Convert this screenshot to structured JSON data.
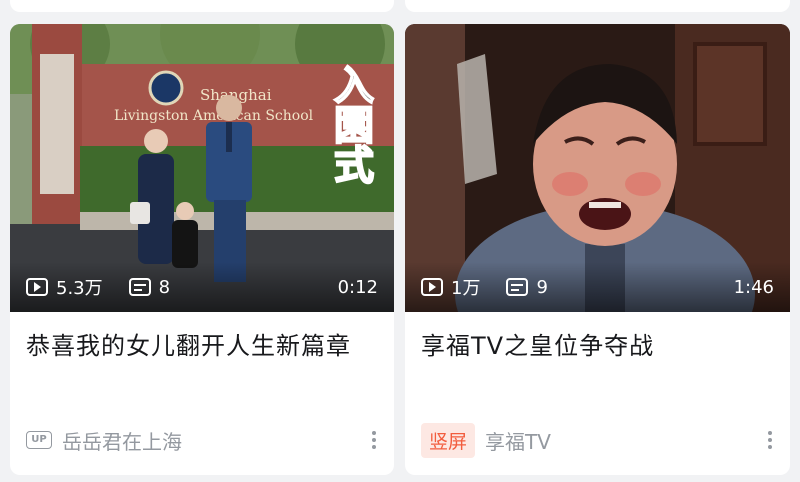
{
  "cards": [
    {
      "views": "5.3万",
      "danmaku": "8",
      "duration": "0:12",
      "title": "恭喜我的女儿翻开人生新篇章",
      "badge": "UP",
      "author": "岳岳君在上海",
      "overlay_text": "入園式",
      "sign_lines": [
        "Shanghai",
        "Livingston American School"
      ]
    },
    {
      "views": "1万",
      "danmaku": "9",
      "duration": "1:46",
      "title": "享福TV之皇位争夺战",
      "badge": "竖屏",
      "author": "享福TV"
    }
  ],
  "icons": [
    "play-icon",
    "danmaku-icon",
    "more-icon",
    "up-badge"
  ],
  "colors": {
    "tag_bg": "#fde8e3",
    "tag_text": "#f25d3e",
    "meta_gray": "#9499a0"
  }
}
